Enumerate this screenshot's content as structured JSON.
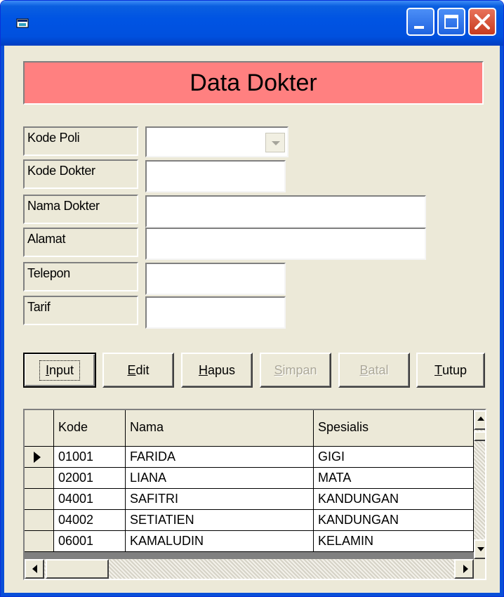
{
  "window": {
    "icons": [
      "app-icon",
      "minimize-icon",
      "maximize-icon",
      "close-icon"
    ]
  },
  "banner": {
    "title": "Data Dokter",
    "bg_color": "#ff8080"
  },
  "form": {
    "labels": {
      "kode_poli": "Kode Poli",
      "kode_dokter": "Kode Dokter",
      "nama_dokter": "Nama Dokter",
      "alamat": "Alamat",
      "telepon": "Telepon",
      "tarif": "Tarif"
    },
    "values": {
      "kode_poli": "",
      "kode_dokter": "",
      "nama_dokter": "",
      "alamat": "",
      "telepon": "",
      "tarif": ""
    }
  },
  "buttons": {
    "input": {
      "hot": "I",
      "rest": "nput"
    },
    "edit": {
      "hot": "E",
      "rest": "dit"
    },
    "hapus": {
      "hot": "H",
      "rest": "apus"
    },
    "simpan": {
      "hot": "S",
      "rest": "impan"
    },
    "batal": {
      "hot": "B",
      "rest": "atal"
    },
    "tutup": {
      "hot": "T",
      "rest": "utup"
    }
  },
  "grid": {
    "columns": [
      "Kode",
      "Nama",
      "Spesialis"
    ],
    "rows": [
      [
        "01001",
        "FARIDA",
        "GIGI"
      ],
      [
        "02001",
        "LIANA",
        "MATA"
      ],
      [
        "04001",
        "SAFITRI",
        "KANDUNGAN"
      ],
      [
        "04002",
        "SETIATIEN",
        "KANDUNGAN"
      ],
      [
        "06001",
        "KAMALUDIN",
        "KELAMIN"
      ]
    ],
    "selected_row": 0
  }
}
